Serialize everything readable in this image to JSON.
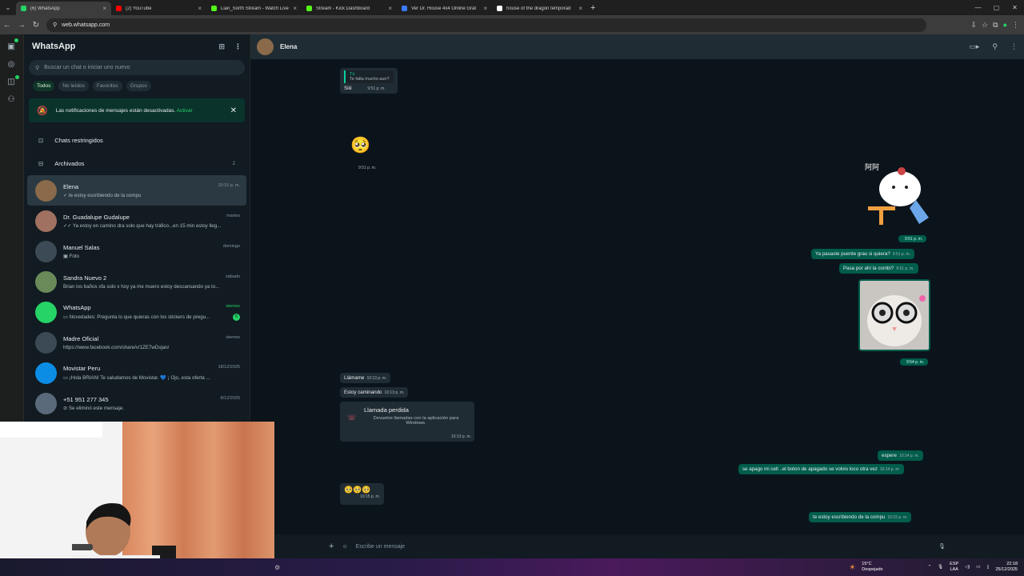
{
  "browser": {
    "tabs": [
      {
        "label": "(6) WhatsApp",
        "color": "#25d366",
        "active": true
      },
      {
        "label": "(2) YouTube",
        "color": "#ff0000",
        "active": false
      },
      {
        "label": "Lian_Sorth Stream - Watch Live",
        "color": "#53fc18",
        "active": false
      },
      {
        "label": "Stream - Kick Dashboard",
        "color": "#53fc18",
        "active": false
      },
      {
        "label": "Ver Dr. House 4x4 Online Grat",
        "color": "#3c7bff",
        "active": false
      },
      {
        "label": "house of the dragon temporad",
        "color": "#ffffff",
        "active": false
      }
    ],
    "url": "web.whatsapp.com"
  },
  "sidebar": {
    "title": "WhatsApp",
    "search_placeholder": "Buscar un chat o iniciar uno nuevo",
    "filters": [
      "Todos",
      "No leídos",
      "Favoritos",
      "Grupos"
    ],
    "notice": {
      "text": "Las notificaciones de mensajes están desactivadas.",
      "action": "Activar"
    },
    "restricted": "Chats restringidos",
    "archived": {
      "label": "Archivados",
      "count": "2"
    },
    "chats": [
      {
        "name": "Elena",
        "time": "10:15 p. m.",
        "preview": "✓ te estoy escribiendo de la compu",
        "color": "#8a6a4a",
        "selected": true
      },
      {
        "name": "Dr. Guadalupe Gudalupe",
        "time": "martes",
        "preview": "✓✓ Ya estoy en camino dra solo que hay tráfico...en 15 min estoy lleg...",
        "color": "#a07060"
      },
      {
        "name": "Manuel Salas",
        "time": "domingo",
        "preview": "▣ Foto",
        "color": "#3b4a54"
      },
      {
        "name": "Sandra Nuevo 2",
        "time": "sábado",
        "preview": "Brian los baños xfa solo x hoy ya me muero estoy descansando ya to...",
        "color": "#6a8a5a"
      },
      {
        "name": "WhatsApp",
        "time": "viernes",
        "preview": "▭ Novedades: Pregunta lo que quieras con los stickers de pregu...",
        "color": "#25d366",
        "badge": "6"
      },
      {
        "name": "Madre Oficial",
        "time": "viernes",
        "preview": "https://www.facebook.com/share/v/1ZE7wDvjan/",
        "color": "#3b4a54"
      },
      {
        "name": "Movistar Peru",
        "time": "18/12/2025",
        "preview": "▭ ¡Hola BRIAN! Te saludamos de Movistar. 💙 ¡ Ojo, esta oferta ...",
        "color": "#0b8de6"
      },
      {
        "name": "+51 951 277 345",
        "time": "8/12/2025",
        "preview": "⊘ Se eliminó este mensaje.",
        "color": "#5a6a7a"
      }
    ]
  },
  "conversation": {
    "contact": "Elena",
    "input_placeholder": "Escribe un mensaje",
    "messages": [
      {
        "dir": "in",
        "quote_author": "Tú",
        "quote": "Te falta mucho aun?",
        "text": "Siiii",
        "time": "9:51 p. m."
      },
      {
        "dir": "in",
        "text": "🥺",
        "time": "9:51 p. m."
      },
      {
        "dir": "out",
        "text": "",
        "time": "9:51 p. m."
      },
      {
        "dir": "out",
        "text": "Ya pasaste puente grau si quiera?",
        "time": "9:51 p. m."
      },
      {
        "dir": "out",
        "text": "Pasa por ahí la combi?",
        "time": "9:51 p. m."
      },
      {
        "dir": "out",
        "text": "",
        "time": "9:54 p. m."
      },
      {
        "dir": "in",
        "text": "Llámame",
        "time": "10:13 p. m."
      },
      {
        "dir": "in",
        "text": "Estoy caminando",
        "time": "10:13 p. m."
      },
      {
        "dir": "in",
        "call_title": "Llamada perdida",
        "call_sub": "Devuelve llamadas con la aplicación para Windows.",
        "time": "10:13 p. m."
      },
      {
        "dir": "out",
        "text": "espere",
        "time": "10:14 p. m."
      },
      {
        "dir": "out",
        "text": "se apago mi cell ..el boton de apagado se volvio loco otra vez",
        "time": "10:14 p. m."
      },
      {
        "dir": "in",
        "text": "🥺🥺🥺",
        "time": "10:15 p. m."
      },
      {
        "dir": "out",
        "text": "te estoy escribiendo de la compu",
        "time": "10:15 p. m."
      }
    ]
  },
  "taskbar": {
    "weather_temp": "15°C",
    "weather_text": "Despejado",
    "lang": "ESP",
    "lang2": "LAA",
    "time": "22:18",
    "date": "25/12/2025"
  }
}
